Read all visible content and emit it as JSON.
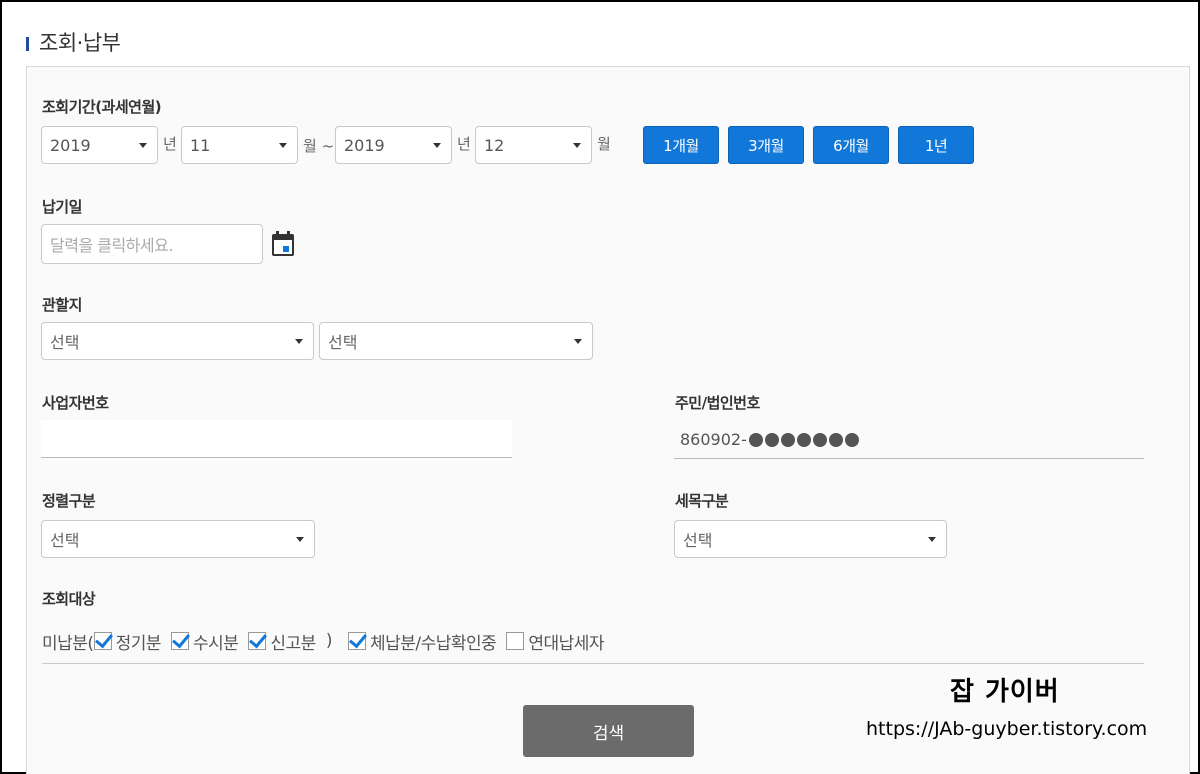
{
  "section": {
    "title": "조회·납부"
  },
  "period": {
    "label": "조회기간(과세연월)",
    "from_year": "2019",
    "from_year_unit": "년",
    "from_month": "11",
    "from_month_unit": "월 ~",
    "to_year": "2019",
    "to_year_unit": "년",
    "to_month": "12",
    "to_month_unit": "월",
    "quick_buttons": [
      "1개월",
      "3개월",
      "6개월",
      "1년"
    ]
  },
  "due_date": {
    "label": "납기일",
    "placeholder": "달력을 클릭하세요."
  },
  "jurisdiction": {
    "label": "관할지",
    "select1": "선택",
    "select2": "선택"
  },
  "business_number": {
    "label": "사업자번호",
    "value": ""
  },
  "resident_number": {
    "label": "주민/법인번호",
    "value": "860902-",
    "masked_digits": 7
  },
  "sort": {
    "label": "정렬구분",
    "value": "선택"
  },
  "tax_item": {
    "label": "세목구분",
    "value": "선택"
  },
  "target": {
    "label": "조회대상",
    "prefix": "미납분(",
    "options": [
      {
        "label": "정기분",
        "checked": true
      },
      {
        "label": "수시분",
        "checked": true
      },
      {
        "label": "신고분",
        "checked": true
      }
    ],
    "close_paren": ")",
    "extra_options": [
      {
        "label": "체납분/수납확인중",
        "checked": true
      },
      {
        "label": "연대납세자",
        "checked": false
      }
    ]
  },
  "search_button": "검색",
  "watermark": {
    "name": "잡 가이버",
    "url": "https://JAb-guyber.tistory.com"
  },
  "colors": {
    "accent": "#1177d9",
    "search_button": "#6b6b6b",
    "panel_bg": "#fafafa"
  }
}
